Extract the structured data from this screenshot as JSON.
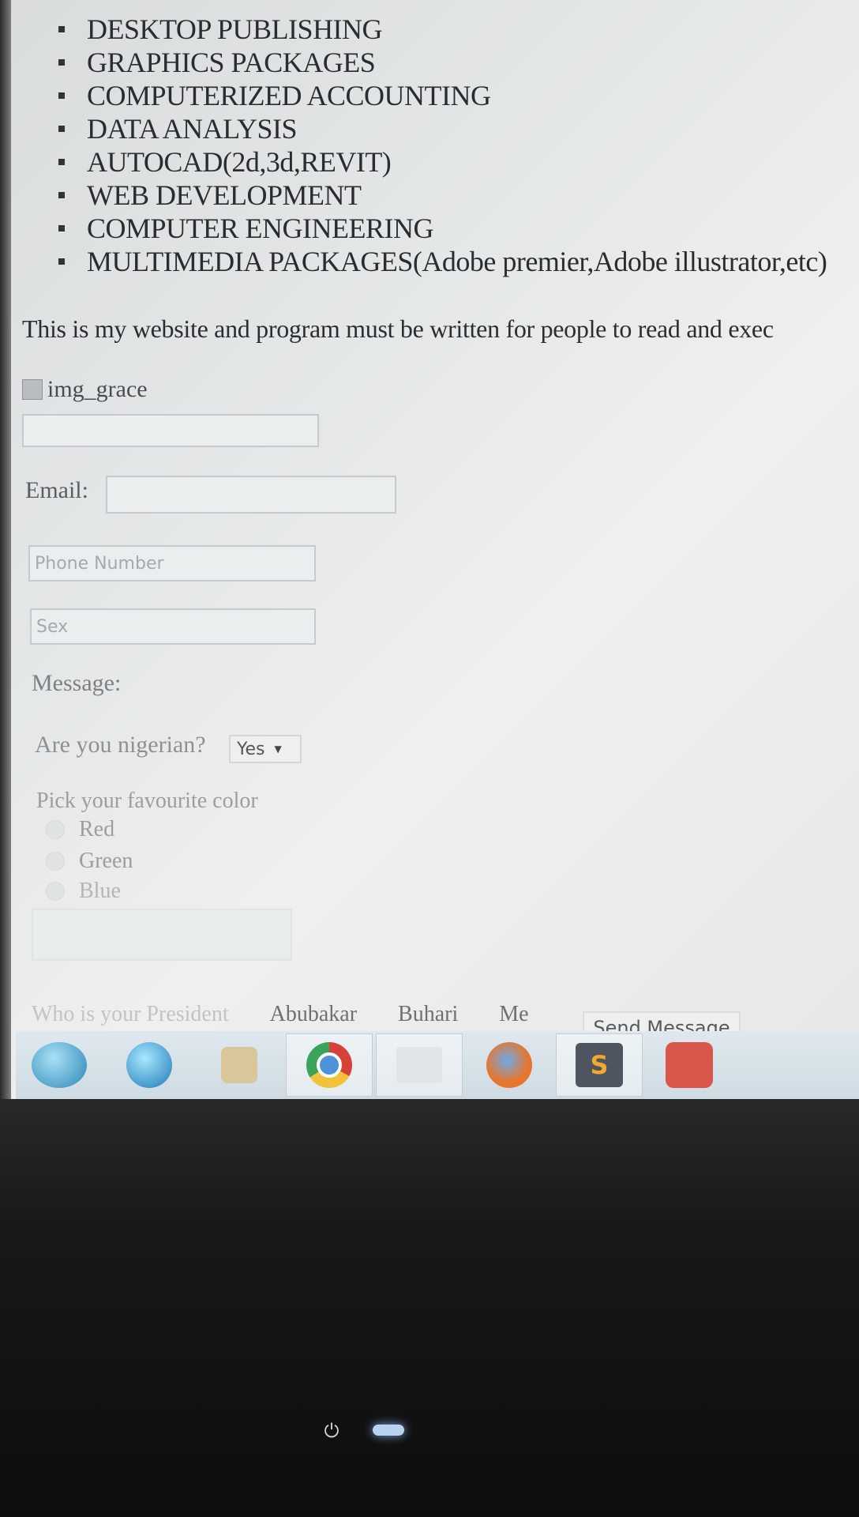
{
  "courses": [
    "DESKTOP PUBLISHING",
    "GRAPHICS PACKAGES",
    "COMPUTERIZED ACCOUNTING",
    "DATA ANALYSIS",
    "AUTOCAD(2d,3d,REVIT)",
    "WEB DEVELOPMENT",
    "COMPUTER ENGINEERING",
    "MULTIMEDIA PACKAGES(Adobe premier,Adobe illustrator,etc)"
  ],
  "intro": "This is my website and program must be written for people to read and exec",
  "image_alt": "img_grace",
  "form": {
    "email_label": "Email:",
    "phone_placeholder": "Phone Number",
    "sex_placeholder": "Sex",
    "message_label": "Message:",
    "nigerian_label": "Are you nigerian?",
    "nigerian_value": "Yes",
    "color_label": "Pick your favourite color",
    "colors": [
      "Red",
      "Green",
      "Blue"
    ],
    "president_label": "Who is your President",
    "president_options": [
      "Abubakar",
      "Buhari",
      "Me"
    ],
    "send_label": "Send Message"
  },
  "taskbar_icons": [
    "start-orb-icon",
    "internet-explorer-icon",
    "media-player-icon",
    "chrome-icon",
    "file-explorer-icon",
    "firefox-icon",
    "sublime-text-icon",
    "app-icon"
  ],
  "sublime_glyph": "S",
  "power_glyph": "⏻"
}
